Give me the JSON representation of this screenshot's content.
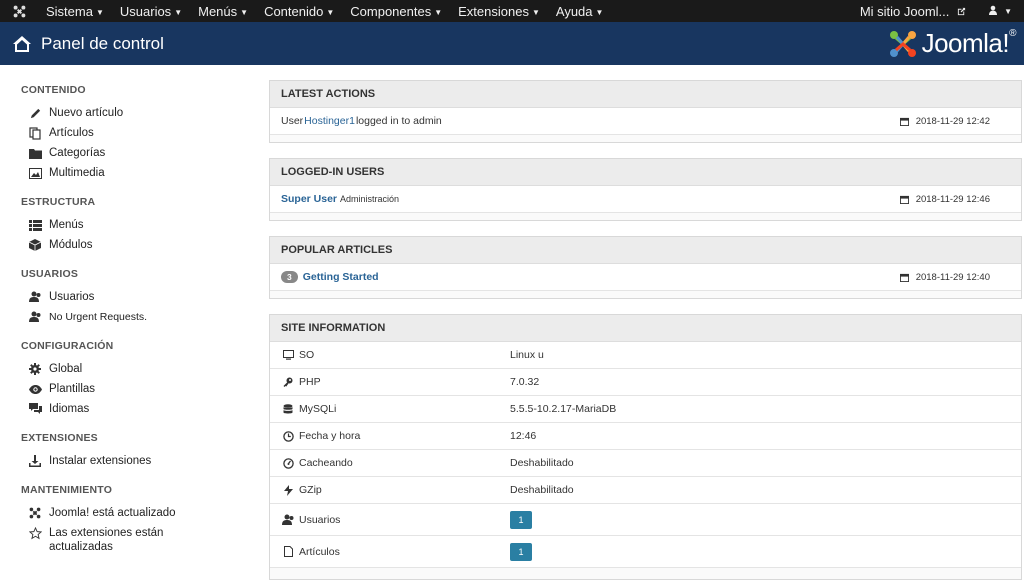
{
  "topbar": {
    "menus": [
      {
        "label": "Sistema"
      },
      {
        "label": "Usuarios"
      },
      {
        "label": "Menús"
      },
      {
        "label": "Contenido"
      },
      {
        "label": "Componentes"
      },
      {
        "label": "Extensiones"
      },
      {
        "label": "Ayuda"
      }
    ],
    "site_label": "Mi sitio Jooml...",
    "caret": "▼",
    "user_caret": "▼"
  },
  "header": {
    "title": "Panel de control",
    "brand": "Joomla!",
    "reg": "®"
  },
  "sidebar": {
    "sections": [
      {
        "title": "CONTENIDO",
        "items": [
          {
            "label": "Nuevo artículo",
            "icon": "pencil-icon"
          },
          {
            "label": "Artículos",
            "icon": "copy-icon"
          },
          {
            "label": "Categorías",
            "icon": "folder-icon"
          },
          {
            "label": "Multimedia",
            "icon": "image-icon"
          }
        ]
      },
      {
        "title": "ESTRUCTURA",
        "items": [
          {
            "label": "Menús",
            "icon": "list-icon"
          },
          {
            "label": "Módulos",
            "icon": "cube-icon"
          }
        ]
      },
      {
        "title": "USUARIOS",
        "items": [
          {
            "label": "Usuarios",
            "icon": "users-icon"
          },
          {
            "label": "No Urgent Requests.",
            "icon": "users-icon"
          }
        ]
      },
      {
        "title": "CONFIGURACIÓN",
        "items": [
          {
            "label": "Global",
            "icon": "gear-icon"
          },
          {
            "label": "Plantillas",
            "icon": "eye-icon"
          },
          {
            "label": "Idiomas",
            "icon": "comments-icon"
          }
        ]
      },
      {
        "title": "EXTENSIONES",
        "items": [
          {
            "label": "Instalar extensiones",
            "icon": "download-icon"
          }
        ]
      },
      {
        "title": "MANTENIMIENTO",
        "items": [
          {
            "label": "Joomla! está actualizado",
            "icon": "joomla-icon"
          },
          {
            "label": "Las extensiones están actualizadas",
            "icon": "star-icon"
          }
        ]
      }
    ]
  },
  "latest_actions": {
    "title": "LATEST ACTIONS",
    "row": {
      "prefix": "User ",
      "user": "Hostinger1",
      "suffix": " logged in to admin",
      "date": "2018-11-29 12:42"
    }
  },
  "logged_in": {
    "title": "LOGGED-IN USERS",
    "row": {
      "user": "Super User",
      "area": "Administración",
      "date": "2018-11-29 12:46"
    }
  },
  "popular": {
    "title": "POPULAR ARTICLES",
    "row": {
      "hits": "3",
      "article": "Getting Started",
      "date": "2018-11-29 12:40"
    }
  },
  "site_info": {
    "title": "SITE INFORMATION",
    "rows": [
      {
        "key": "SO",
        "value": "Linux u",
        "icon": "desktop-icon"
      },
      {
        "key": "PHP",
        "value": "7.0.32",
        "icon": "key-icon"
      },
      {
        "key": "MySQLi",
        "value": "5.5.5-10.2.17-MariaDB",
        "icon": "database-icon"
      },
      {
        "key": "Fecha y hora",
        "value": "12:46",
        "icon": "clock-icon"
      },
      {
        "key": "Cacheando",
        "value": "Deshabilitado",
        "icon": "dashboard-icon"
      },
      {
        "key": "GZip",
        "value": "Deshabilitado",
        "icon": "lightning-icon"
      },
      {
        "key": "Usuarios",
        "value": "1",
        "icon": "users-icon"
      },
      {
        "key": "Artículos",
        "value": "1",
        "icon": "file-icon"
      }
    ]
  },
  "colors": {
    "topbar": "#1a1a1a",
    "header": "#183660",
    "link": "#2a6496",
    "button": "#2a7fa3"
  }
}
